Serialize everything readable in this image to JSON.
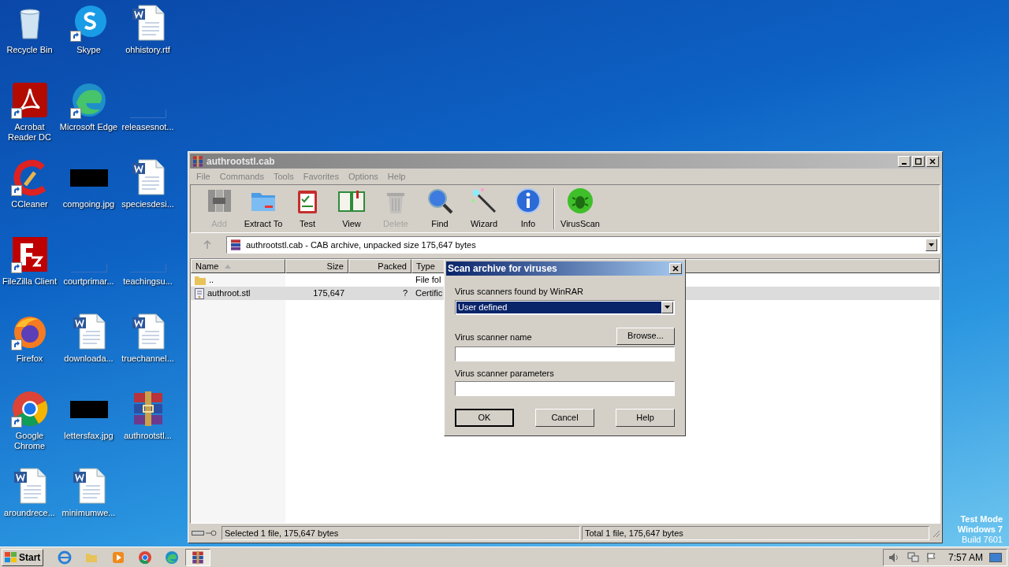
{
  "desktop": {
    "icons": [
      {
        "label": "Recycle Bin",
        "kind": "recycle",
        "shortcut": false
      },
      {
        "label": "Skype",
        "kind": "skype",
        "shortcut": true
      },
      {
        "label": "ohhistory.rtf",
        "kind": "word",
        "shortcut": false
      },
      {
        "label": "Acrobat Reader DC",
        "kind": "acrobat",
        "shortcut": true
      },
      {
        "label": "Microsoft Edge",
        "kind": "edge",
        "shortcut": true
      },
      {
        "label": "releasesnot...",
        "kind": "blank",
        "shortcut": false
      },
      {
        "label": "CCleaner",
        "kind": "ccleaner",
        "shortcut": true
      },
      {
        "label": "comgoing.jpg",
        "kind": "dark",
        "shortcut": false
      },
      {
        "label": "speciesdesi...",
        "kind": "word",
        "shortcut": false
      },
      {
        "label": "FileZilla Client",
        "kind": "filezilla",
        "shortcut": true
      },
      {
        "label": "courtprimar...",
        "kind": "blank",
        "shortcut": false
      },
      {
        "label": "teachingsu...",
        "kind": "blank",
        "shortcut": false
      },
      {
        "label": "Firefox",
        "kind": "firefox",
        "shortcut": true
      },
      {
        "label": "downloada...",
        "kind": "word",
        "shortcut": false
      },
      {
        "label": "truechannel...",
        "kind": "word",
        "shortcut": false
      },
      {
        "label": "Google Chrome",
        "kind": "chrome",
        "shortcut": true
      },
      {
        "label": "lettersfax.jpg",
        "kind": "dark",
        "shortcut": false
      },
      {
        "label": "authrootstl...",
        "kind": "winrar",
        "shortcut": false
      },
      {
        "label": "aroundrece...",
        "kind": "word",
        "shortcut": false
      },
      {
        "label": "minimumwe...",
        "kind": "word",
        "shortcut": false
      }
    ],
    "system_text": [
      "Test Mode",
      "Windows 7",
      "Build 7601"
    ]
  },
  "window": {
    "title": "authrootstl.cab",
    "menu": [
      "File",
      "Commands",
      "Tools",
      "Favorites",
      "Options",
      "Help"
    ],
    "toolbar": [
      {
        "label": "Add",
        "kind": "add",
        "disabled": true
      },
      {
        "label": "Extract To",
        "kind": "extract",
        "disabled": false
      },
      {
        "label": "Test",
        "kind": "test",
        "disabled": false
      },
      {
        "label": "View",
        "kind": "view",
        "disabled": false
      },
      {
        "label": "Delete",
        "kind": "delete",
        "disabled": true
      },
      {
        "label": "Find",
        "kind": "find",
        "disabled": false
      },
      {
        "label": "Wizard",
        "kind": "wizard",
        "disabled": false
      },
      {
        "label": "Info",
        "kind": "info",
        "disabled": false
      },
      {
        "label": "VirusScan",
        "kind": "virus",
        "disabled": false
      }
    ],
    "address": "authrootstl.cab - CAB archive, unpacked size 175,647 bytes",
    "columns": [
      "Name",
      "Size",
      "Packed",
      "Type"
    ],
    "rows": [
      {
        "kind": "folder",
        "cells": [
          "..",
          "",
          "",
          "File fol"
        ],
        "selected": false
      },
      {
        "kind": "file",
        "cells": [
          "authroot.stl",
          "175,647",
          "?",
          "Certific"
        ],
        "selected": true
      }
    ],
    "status_left": "Selected 1 file, 175,647 bytes",
    "status_right": "Total 1 file, 175,647 bytes"
  },
  "dialog": {
    "title": "Scan archive for viruses",
    "scanner_label": "Virus scanners found by WinRAR",
    "scanner_value": "User defined",
    "name_label": "Virus scanner name",
    "browse": "Browse...",
    "params_label": "Virus scanner parameters",
    "buttons": [
      "OK",
      "Cancel",
      "Help"
    ]
  },
  "taskbar": {
    "start": "Start",
    "time": "7:57 AM"
  }
}
